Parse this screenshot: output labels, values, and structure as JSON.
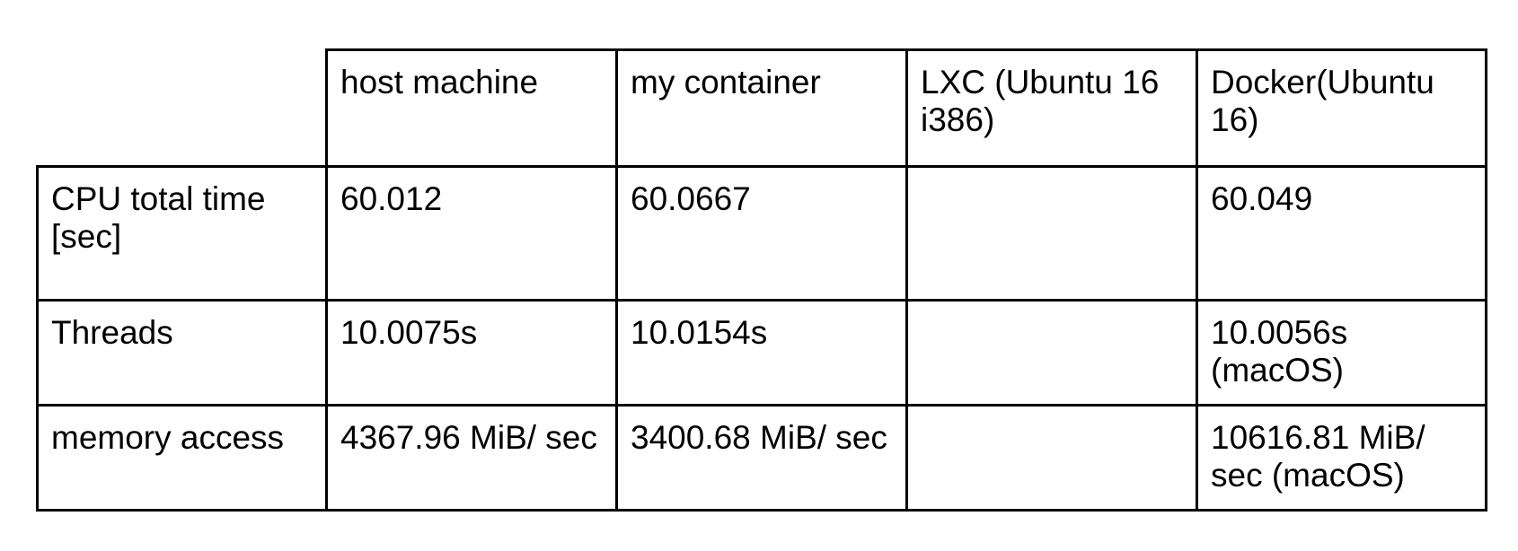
{
  "table": {
    "columns": [
      "",
      "host machine",
      "my container",
      "LXC (Ubuntu 16 i386)",
      "Docker(Ubuntu 16)"
    ],
    "rows": [
      {
        "label": "CPU  total time [sec]",
        "cells": [
          "60.012",
          "60.0667",
          "",
          "60.049"
        ]
      },
      {
        "label": "Threads",
        "cells": [
          "10.0075s",
          "10.0154s",
          "",
          "10.0056s (macOS)"
        ]
      },
      {
        "label": "memory access",
        "cells": [
          "4367.96 MiB/ sec",
          "3400.68 MiB/ sec",
          "",
          "10616.81 MiB/ sec (macOS)"
        ]
      }
    ]
  }
}
